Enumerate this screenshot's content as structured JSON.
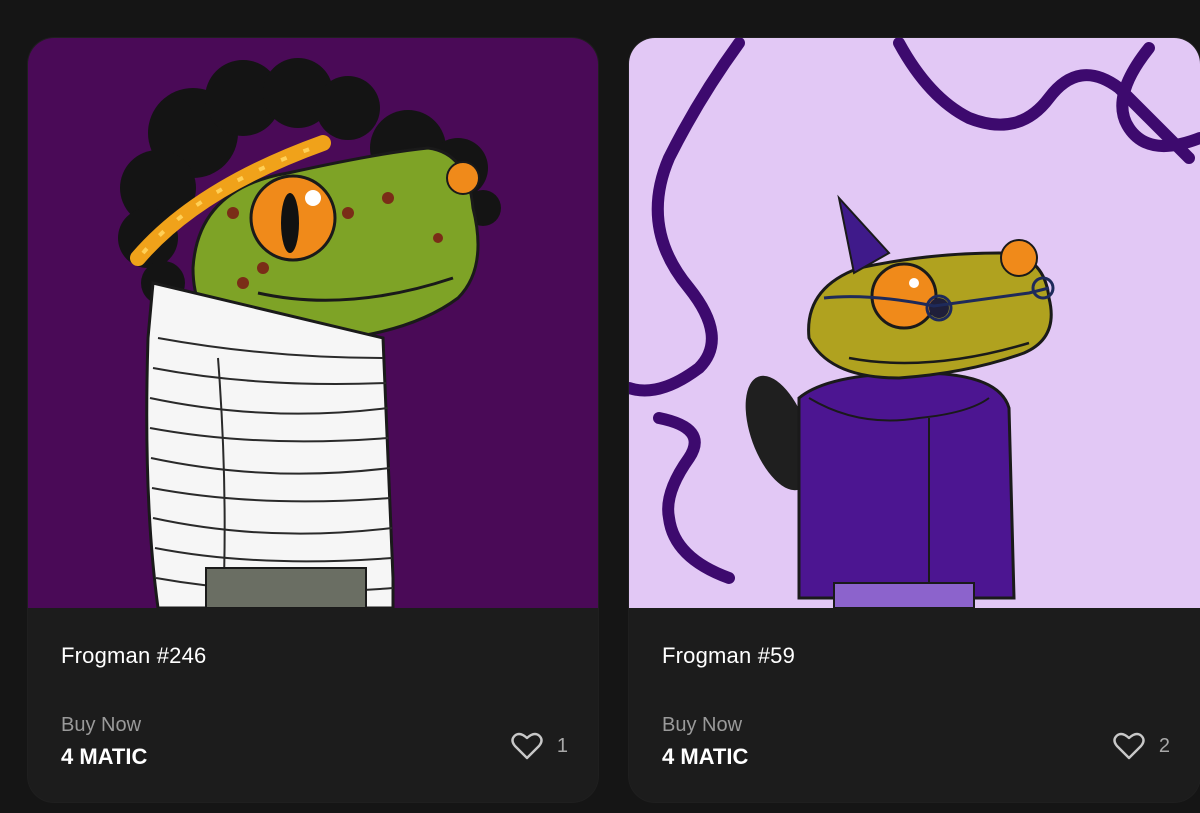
{
  "cards": [
    {
      "title": "Frogman #246",
      "sale_label": "Buy Now",
      "price": "4 MATIC",
      "likes": "1",
      "background": "#4a0a57"
    },
    {
      "title": "Frogman #59",
      "sale_label": "Buy Now",
      "price": "4 MATIC",
      "likes": "2",
      "background": "#e2c8f5"
    }
  ],
  "icons": {
    "like": "heart-outline-icon"
  }
}
